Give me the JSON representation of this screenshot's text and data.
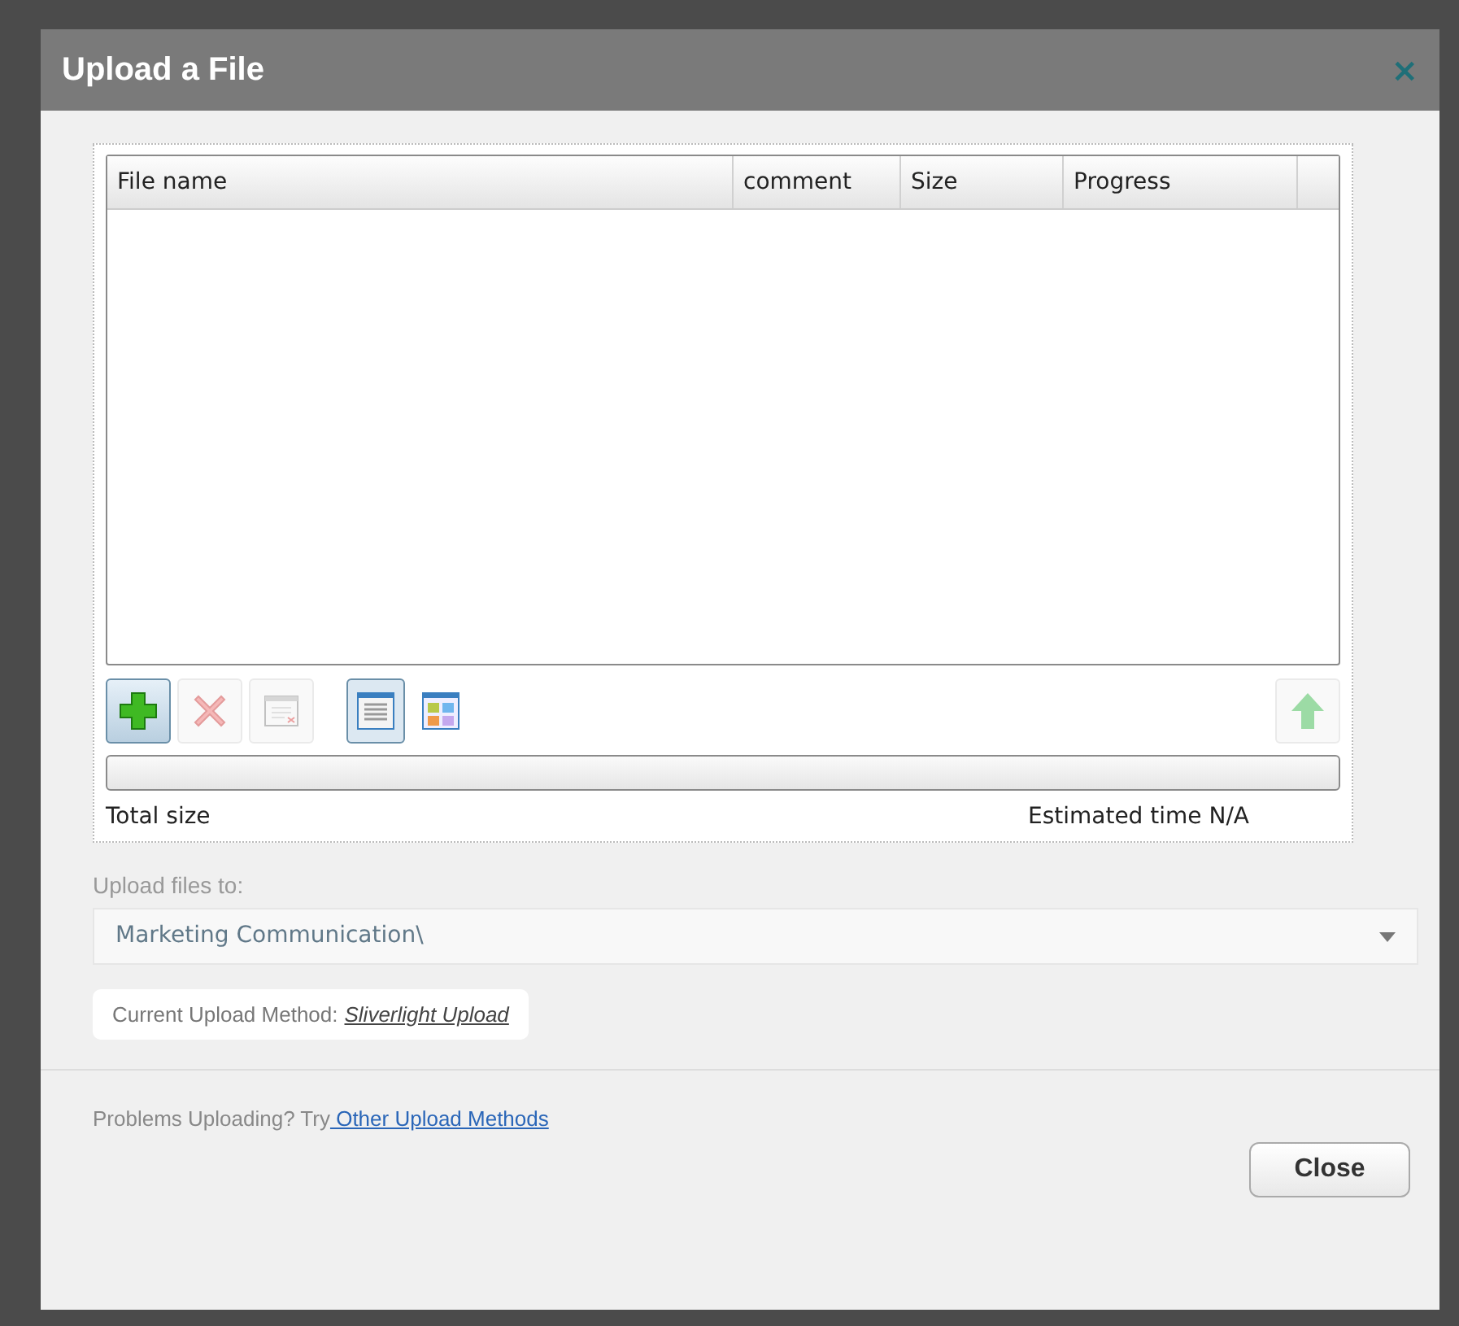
{
  "dialog": {
    "title": "Upload a File",
    "close_icon": "×"
  },
  "file_table": {
    "columns": [
      "File name",
      "comment",
      "Size",
      "Progress"
    ]
  },
  "toolbar": {
    "actions": [
      {
        "kind": "add",
        "disabled": false
      },
      {
        "kind": "remove",
        "disabled": true
      },
      {
        "kind": "clear",
        "disabled": true
      }
    ],
    "views": [
      {
        "kind": "list",
        "selected": true
      },
      {
        "kind": "tiles",
        "selected": false
      }
    ],
    "upload": {
      "disabled": true
    }
  },
  "progress": {
    "level": 0
  },
  "totals": {
    "total_size": "Total size",
    "estimated_time": "Estimated time N/A"
  },
  "destination": {
    "label": "Upload files to:",
    "value": "Marketing Communication\\"
  },
  "method": {
    "label": "Current Upload Method:",
    "link": "Sliverlight Upload"
  },
  "help": {
    "text": "Problems Uploading? Try",
    "link": " Other Upload Methods"
  },
  "buttons": [
    "Close"
  ]
}
